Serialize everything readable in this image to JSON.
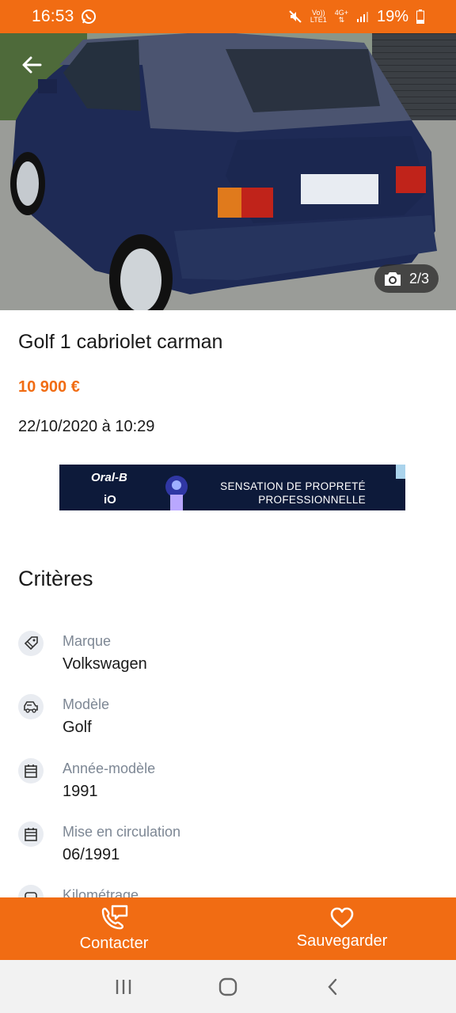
{
  "status_bar": {
    "time": "16:53",
    "network_top": "Vo))",
    "network_bottom": "LTE1",
    "data_top": "4G+",
    "battery": "19%",
    "bg_color": "#f16c13"
  },
  "gallery": {
    "counter": "2/3",
    "camera_icon": "camera-icon",
    "back_icon": "arrow-left-icon"
  },
  "listing": {
    "title": "Golf 1 cabriolet carman",
    "price": "10 900 €",
    "date": "22/10/2020 à 10:29",
    "price_color": "#f16c13"
  },
  "ad": {
    "brand": "Oral-B",
    "model": "iO",
    "line1": "SENSATION DE PROPRETÉ",
    "line2": "PROFESSIONNELLE"
  },
  "criteria": {
    "title": "Critères",
    "items": [
      {
        "label": "Marque",
        "value": "Volkswagen",
        "icon": "tag-icon"
      },
      {
        "label": "Modèle",
        "value": "Golf",
        "icon": "car-icon"
      },
      {
        "label": "Année-modèle",
        "value": "1991",
        "icon": "calendar-icon"
      },
      {
        "label": "Mise en circulation",
        "value": "06/1991",
        "icon": "calendar-icon"
      },
      {
        "label": "Kilométrage",
        "value": "",
        "icon": "gauge-icon"
      }
    ]
  },
  "actions": {
    "contact": "Contacter",
    "save": "Sauvegarder"
  }
}
